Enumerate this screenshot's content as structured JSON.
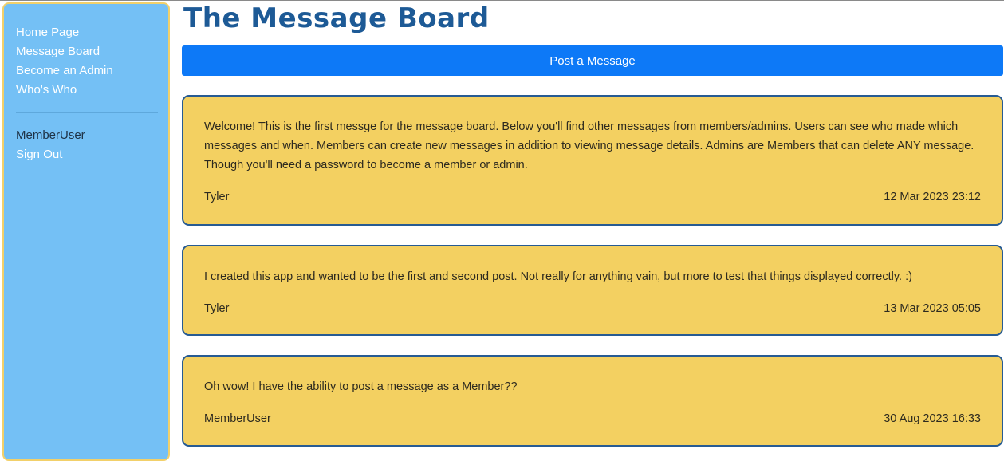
{
  "sidebar": {
    "links": [
      {
        "label": "Home Page"
      },
      {
        "label": "Message Board"
      },
      {
        "label": "Become an Admin"
      },
      {
        "label": "Who's Who"
      }
    ],
    "user": {
      "name": "MemberUser",
      "sign_out": "Sign Out"
    }
  },
  "header": {
    "title": "The Message Board",
    "post_button": "Post a Message"
  },
  "messages": [
    {
      "text": "Welcome! This is the first messge for the message board. Below you'll find other messages from members/admins. Users can see who made which messages and when. Members can create new messages in addition to viewing message details. Admins are Members that can delete ANY message. Though you'll need a password to become a member or admin.",
      "author": "Tyler",
      "date": "12 Mar 2023 23:12"
    },
    {
      "text": "I created this app and wanted to be the first and second post. Not really for anything vain, but more to test that things displayed correctly. :)",
      "author": "Tyler",
      "date": "13 Mar 2023 05:05"
    },
    {
      "text": "Oh wow! I have the ability to post a message as a Member??",
      "author": "MemberUser",
      "date": "30 Aug 2023 16:33"
    }
  ],
  "colors": {
    "sidebar_bg": "#74c0f5",
    "sidebar_border": "#f2d06a",
    "title": "#1d5a96",
    "button": "#0d79f7",
    "card_bg": "#f3d061",
    "card_border": "#275b93"
  }
}
